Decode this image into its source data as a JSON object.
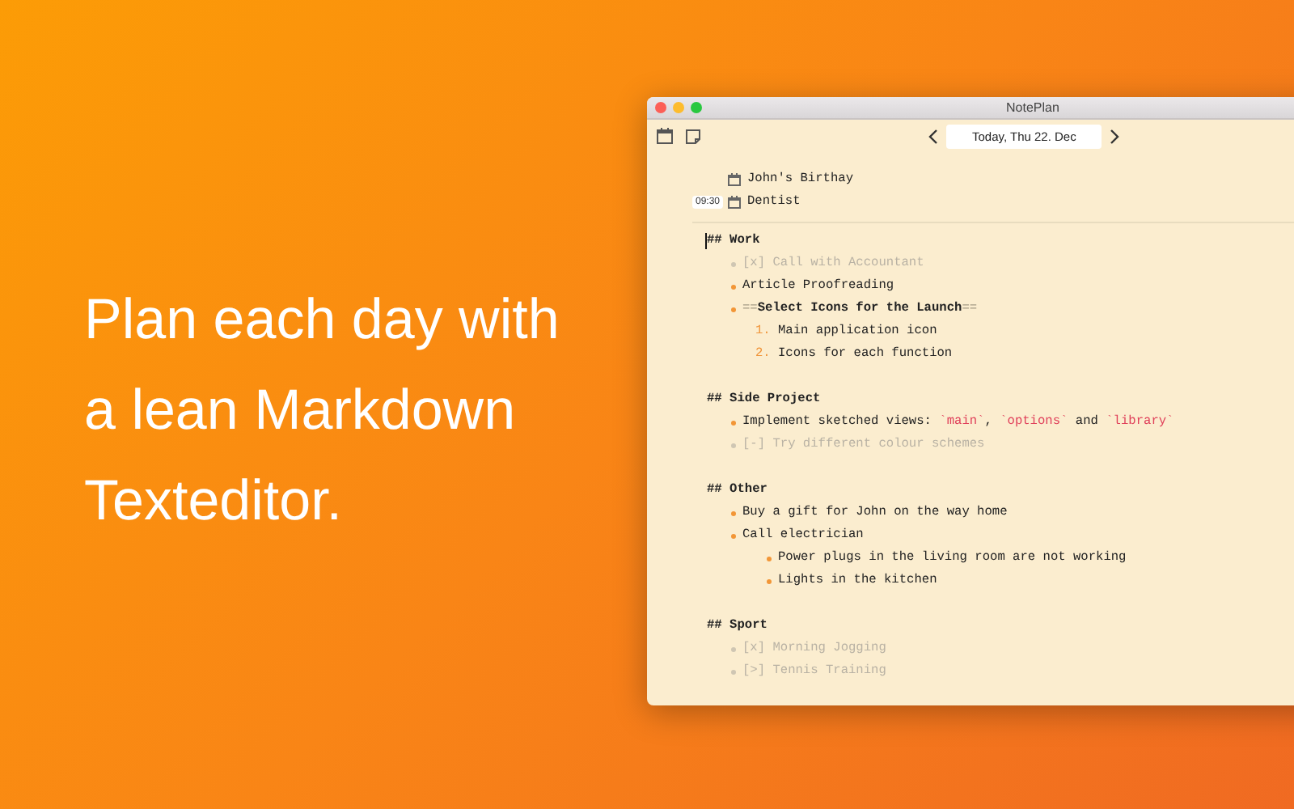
{
  "headline": "Plan each day with\na lean Markdown\nTexteditor.",
  "window": {
    "title": "NotePlan"
  },
  "toolbar": {
    "date": "Today, Thu 22. Dec"
  },
  "events": [
    {
      "text": "John's Birthay"
    },
    {
      "time": "09:30",
      "text": "Dentist"
    }
  ],
  "sections": [
    {
      "heading": "## Work",
      "cursor": true,
      "items": [
        {
          "kind": "task",
          "finished": true,
          "text": "[x] Call with Accountant"
        },
        {
          "kind": "task",
          "finished": false,
          "text": "Article Proofreading"
        },
        {
          "kind": "task",
          "finished": false,
          "parts": [
            {
              "kind": "marker",
              "text": "=="
            },
            {
              "kind": "bold",
              "text": "Select Icons for the Launch"
            },
            {
              "kind": "marker",
              "text": "=="
            }
          ],
          "children": [
            {
              "kind": "numbered",
              "number": "1.",
              "text": "Main application icon"
            },
            {
              "kind": "numbered",
              "number": "2.",
              "text": "Icons for each function"
            }
          ]
        }
      ]
    },
    {
      "heading": "## Side Project",
      "cursor": false,
      "items": [
        {
          "kind": "task",
          "finished": false,
          "parts": [
            {
              "kind": "plain",
              "text": "Implement sketched views: "
            },
            {
              "kind": "code",
              "text": "`main`"
            },
            {
              "kind": "plain",
              "text": ", "
            },
            {
              "kind": "code",
              "text": "`options`"
            },
            {
              "kind": "plain",
              "text": " and "
            },
            {
              "kind": "code",
              "text": "`library`"
            }
          ]
        },
        {
          "kind": "task",
          "finished": true,
          "text": "[-] Try different colour schemes"
        }
      ]
    },
    {
      "heading": "## Other",
      "cursor": false,
      "items": [
        {
          "kind": "task",
          "finished": false,
          "text": "Buy a gift for John on the way home"
        },
        {
          "kind": "task",
          "finished": false,
          "text": "Call electrician",
          "children": [
            {
              "kind": "task",
              "finished": false,
              "text": "Power plugs in the living room are not working"
            },
            {
              "kind": "task",
              "finished": false,
              "text": "Lights in the kitchen"
            }
          ]
        }
      ]
    },
    {
      "heading": "## Sport",
      "cursor": false,
      "items": [
        {
          "kind": "task",
          "finished": true,
          "text": "[x] Morning Jogging"
        },
        {
          "kind": "task",
          "finished": true,
          "text": "[>] Tennis Training"
        }
      ]
    }
  ]
}
